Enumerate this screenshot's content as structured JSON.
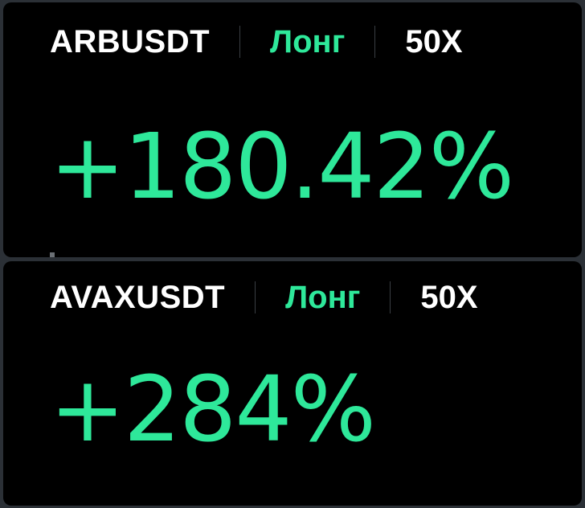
{
  "cards": [
    {
      "pair": "ARBUSDT",
      "side": "Лонг",
      "leverage": "50X",
      "roi": "+180.42%"
    },
    {
      "pair": "AVAXUSDT",
      "side": "Лонг",
      "leverage": "50X",
      "roi": "+284%"
    }
  ],
  "colors": {
    "background": "#000000",
    "accent_green": "#2ee89a",
    "text_white": "#ffffff",
    "divider": "#3a3f44"
  }
}
